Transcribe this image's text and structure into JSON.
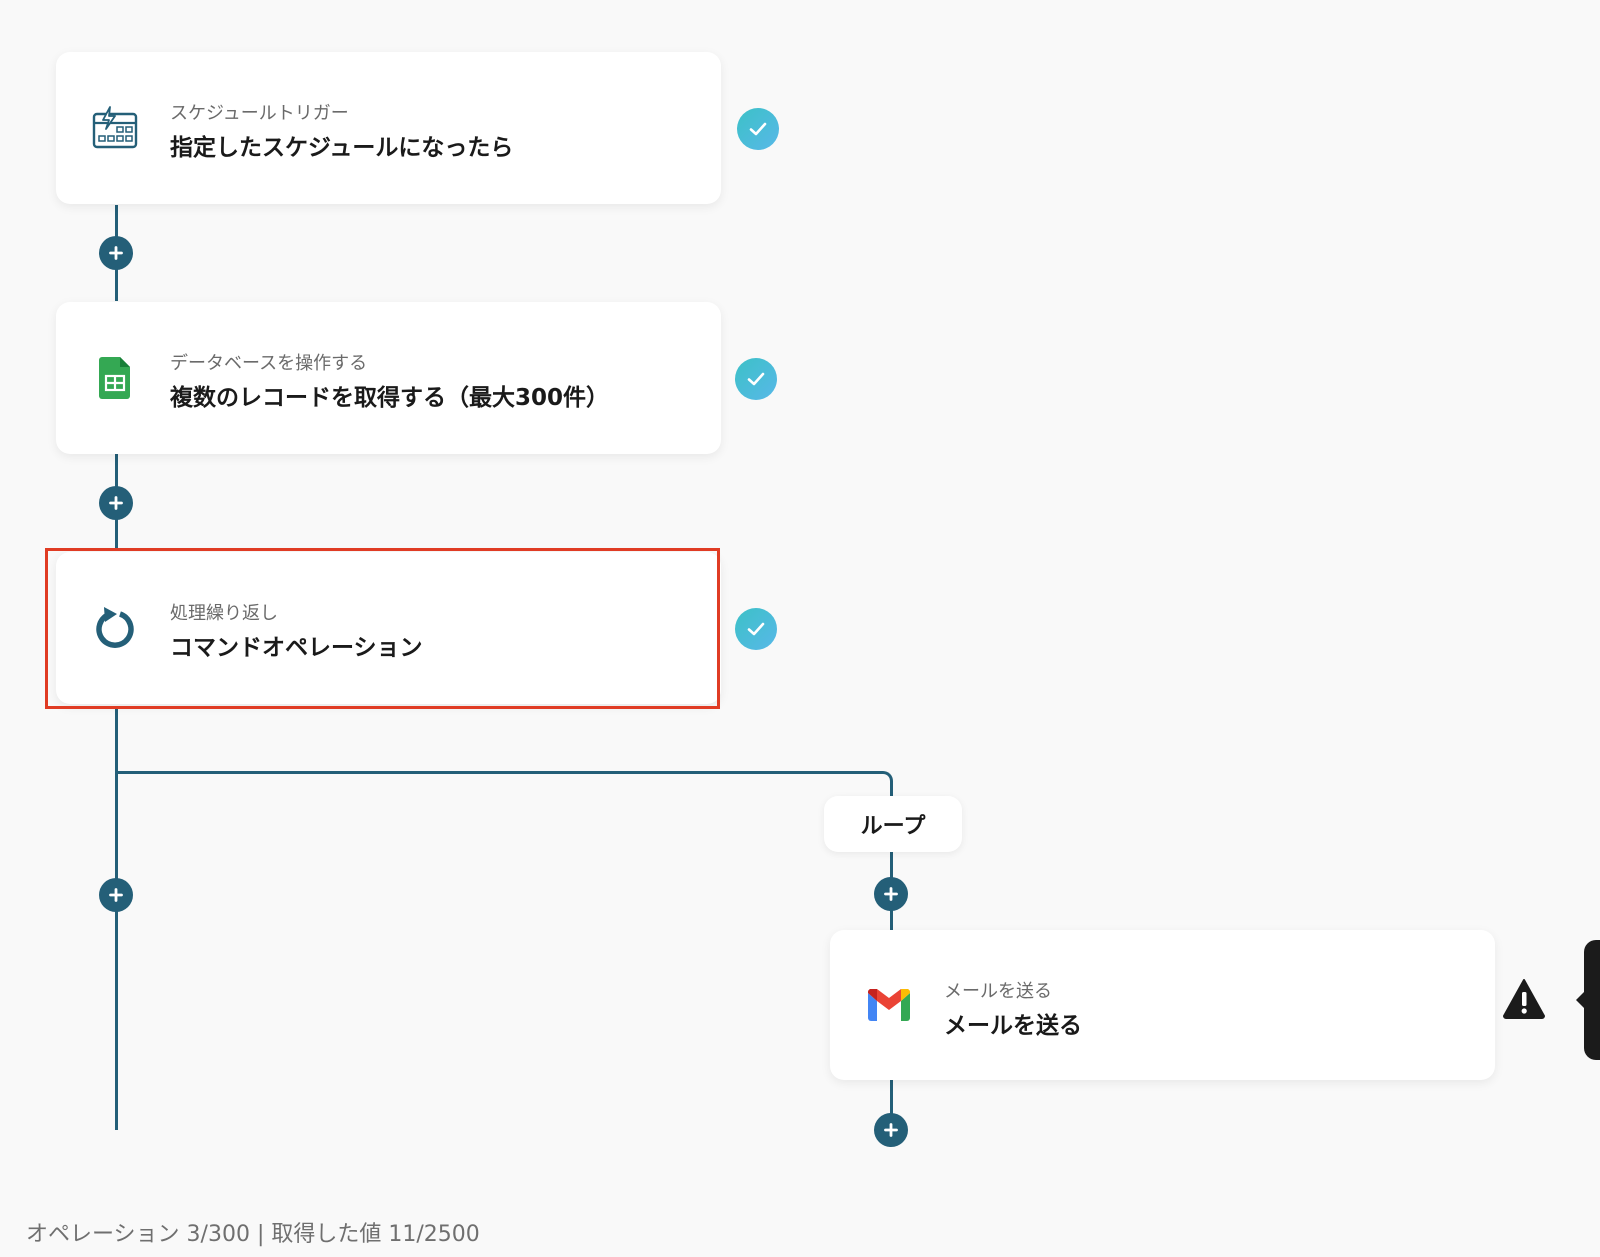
{
  "flow": {
    "steps": [
      {
        "subtitle": "スケジュールトリガー",
        "title": "指定したスケジュールになったら",
        "icon": "schedule-calendar-icon"
      },
      {
        "subtitle": "データベースを操作する",
        "title": "複数のレコードを取得する（最大300件）",
        "icon": "google-sheets-icon"
      },
      {
        "subtitle": "処理繰り返し",
        "title": "コマンドオペレーション",
        "icon": "loop-arrow-icon"
      },
      {
        "subtitle": "メールを送る",
        "title": "メールを送る",
        "icon": "gmail-icon"
      }
    ],
    "loop_label": "ループ"
  },
  "status_bar": {
    "text": "オペレーション 3/300 | 取得した値 11/2500"
  },
  "colors": {
    "background": "#f9f9f9",
    "connector": "#245f78",
    "highlight": "#e03c24",
    "check_start": "#3cc1c7",
    "check_end": "#58b8e8",
    "sheets_green": "#34a853"
  }
}
